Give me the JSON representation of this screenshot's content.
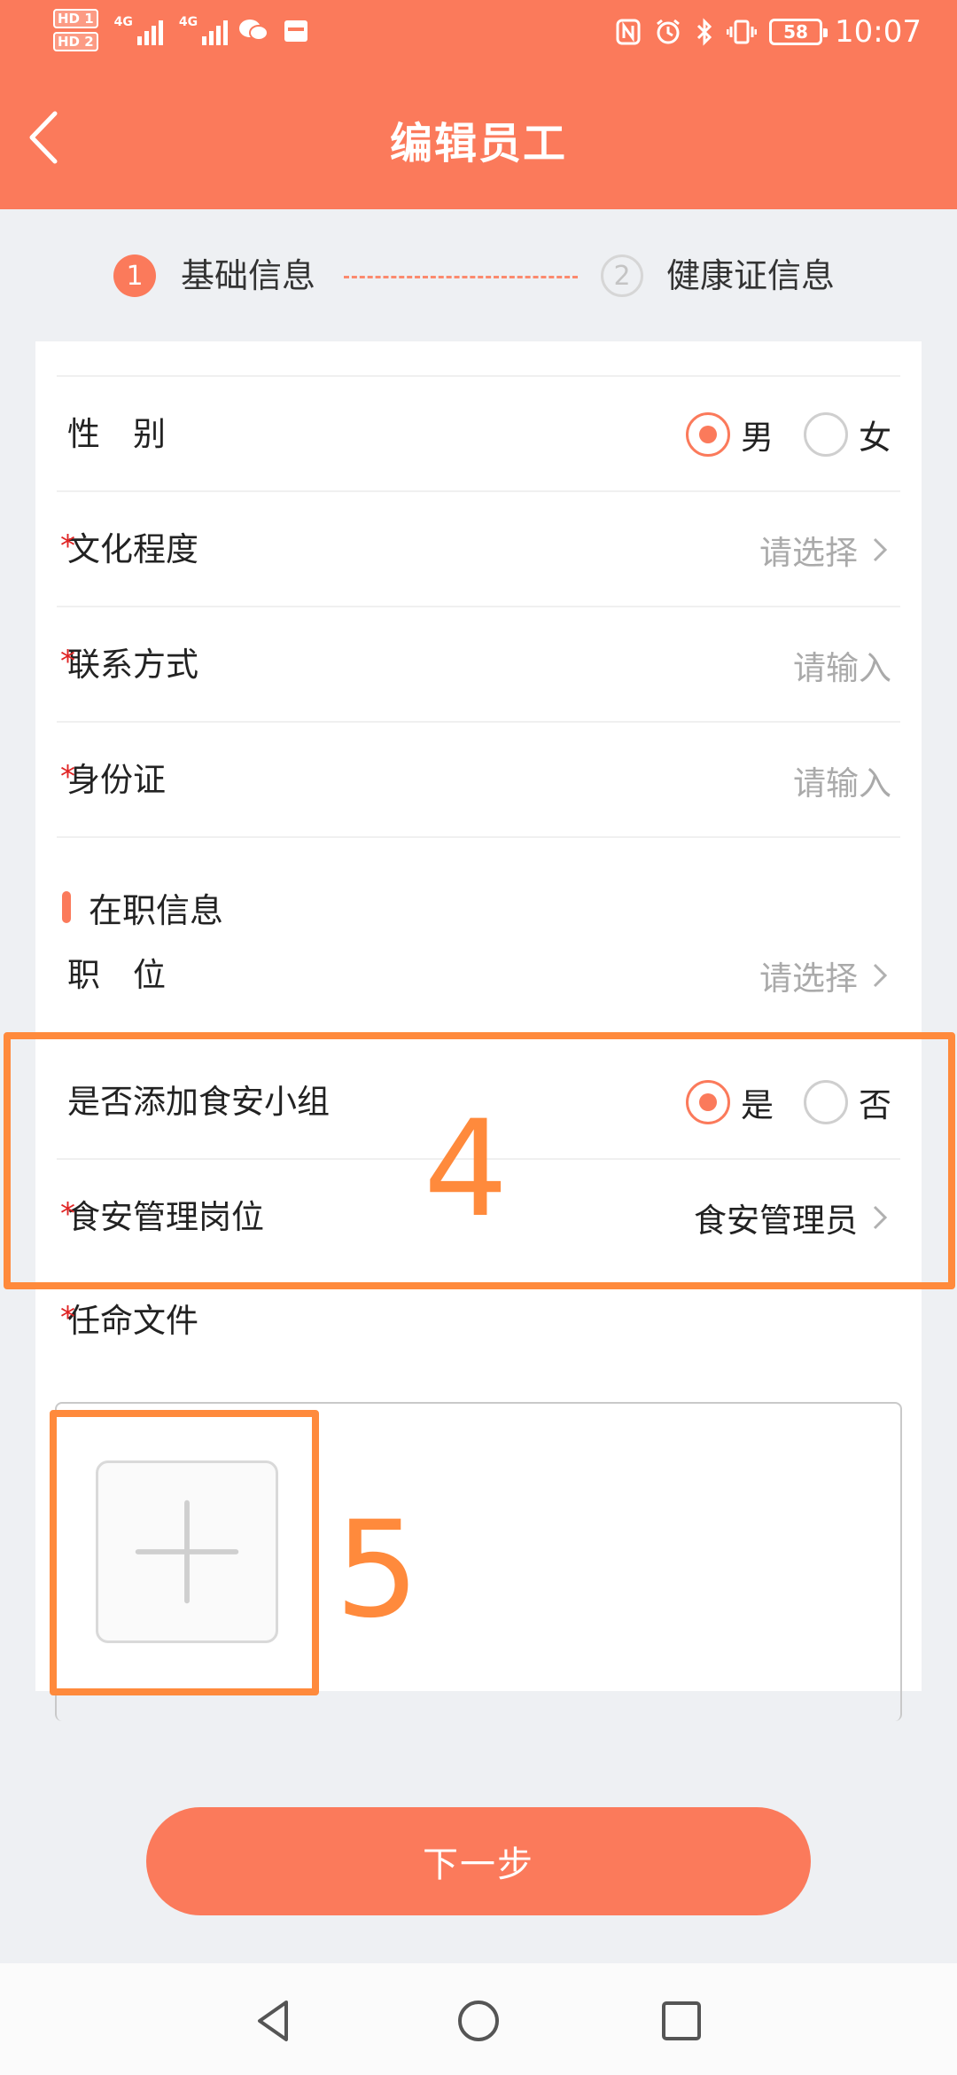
{
  "status_bar": {
    "hd1": "HD 1",
    "hd2": "HD 2",
    "net1": "4G",
    "net2": "4G",
    "battery": "58",
    "time": "10:07"
  },
  "header": {
    "title": "编辑员工",
    "back_icon": "chevron-left-icon",
    "background_color": "#fb7a5b"
  },
  "steps": [
    {
      "num": "1",
      "label": "基础信息",
      "active": true
    },
    {
      "num": "2",
      "label": "健康证信息",
      "active": false
    }
  ],
  "form": {
    "gender": {
      "label": "性　别",
      "option_male": "男",
      "option_female": "女",
      "selected": "男"
    },
    "education": {
      "label": "文化程度",
      "required": "*",
      "placeholder": "请选择"
    },
    "contact": {
      "label": "联系方式",
      "required": "*",
      "placeholder": "请输入"
    },
    "id_card": {
      "label": "身份证",
      "required": "*",
      "placeholder": "请输入"
    },
    "section_title": "在职信息",
    "position": {
      "label": "职　位",
      "placeholder": "请选择"
    },
    "food_safety_group": {
      "label": "是否添加食安小组",
      "option_yes": "是",
      "option_no": "否",
      "selected": "是"
    },
    "food_safety_role": {
      "label": "食安管理岗位",
      "required": "*",
      "value": "食安管理员"
    },
    "appointment_file": {
      "label": "任命文件",
      "required": "*"
    }
  },
  "annotations": {
    "box4": "4",
    "box5": "5"
  },
  "next_button": "下一步",
  "nav": [
    "back-triangle-icon",
    "home-circle-icon",
    "recents-square-icon"
  ]
}
